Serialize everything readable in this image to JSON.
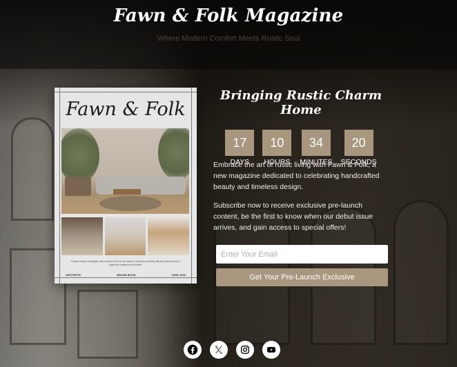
{
  "header": {
    "title": "Fawn & Folk Magazine",
    "tagline": "Where Modern Comfort Meets Rustic Soul"
  },
  "cover": {
    "title": "Fawn & Folk",
    "caption": "Fashion brand campaigns often set the tone for the season, blending creativity with the latest trends to captivate audiences worldwide.",
    "footer_left": "AESTHETIC",
    "footer_center": "BRAND BOOK",
    "footer_right": "JUNE 2030"
  },
  "main": {
    "headline": "Bringing Rustic Charm Home",
    "countdown": [
      {
        "value": "17",
        "label": "DAYS"
      },
      {
        "value": "10",
        "label": "HOURS"
      },
      {
        "value": "34",
        "label": "MINUTES"
      },
      {
        "value": "20",
        "label": "SECONDS"
      }
    ],
    "paragraph1": "Embrace the art of rustic living with Fawn & Folk, a new magazine dedicated to celebrating handcrafted beauty and timeless design.",
    "paragraph2": "Subscribe now to receive exclusive pre-launch content, be the first to know when our debut issue arrives, and gain access to special offers!",
    "email": {
      "value": "",
      "placeholder": "Enter Your Email"
    },
    "cta_label": "Get Your Pre-Launch Exclusive"
  },
  "social": [
    {
      "name": "facebook-icon"
    },
    {
      "name": "x-icon"
    },
    {
      "name": "instagram-icon"
    },
    {
      "name": "youtube-icon"
    }
  ],
  "colors": {
    "accent": "#a8977e",
    "text": "#ffffff",
    "tagline": "#4b4538"
  }
}
